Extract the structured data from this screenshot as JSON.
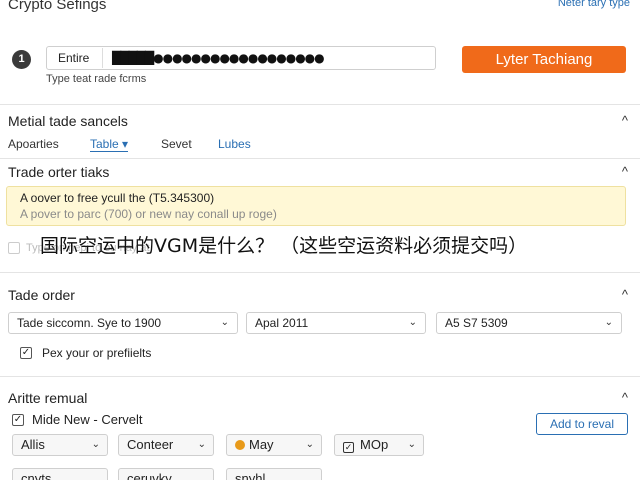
{
  "window": {
    "title": "Crypto Sefings",
    "top_link": "Neter tary type"
  },
  "api_key": {
    "step": "1",
    "label": "Entire",
    "masked_value": "█████●●●●●●●●●●●●●●●●●●",
    "help": "Type teat rade fcrms",
    "button": "Lyter Tachiang"
  },
  "section_metal": {
    "title": "Metial tade sancels",
    "chevron": "^",
    "tabs": [
      {
        "label": "Apoarties"
      },
      {
        "label": "Table ▾"
      },
      {
        "label": "Sevet"
      },
      {
        "label": "Lubes"
      }
    ]
  },
  "section_trade_tiaks": {
    "title": "Trade orter tiaks",
    "chevron": "^",
    "alert_line1": "A oover to free ycull the (T5.345300)",
    "alert_line2": "A pover to parc (700) or new nay conall up roge)",
    "ghost_text": "Type on hepi to ou nay at"
  },
  "overlay_text": "国际空运中的VGM是什么？ （这些空运资料必须提交吗）",
  "section_trade_order": {
    "title": "Tade order",
    "chevron": "^",
    "select1": "Tade siccomn. Sye to 1900",
    "select2": "Apal 2011",
    "select3": "A5 S7 5309",
    "checkbox_mark": "✓",
    "checkbox_label": "Pex your or prefiielts"
  },
  "section_arrite": {
    "title": "Aritte remual",
    "chevron": "^",
    "checkbox_mark": "✓",
    "checkbox_label": "Mide New - Cervelt",
    "add_button": "Add to reval",
    "pills_row1": [
      {
        "label": "Allis"
      },
      {
        "label": "Conteer"
      },
      {
        "label": "May"
      },
      {
        "label": "MOp"
      }
    ],
    "pills_row2": [
      {
        "label": "cnyts"
      },
      {
        "label": "ceruvky"
      },
      {
        "label": "snyhl"
      }
    ],
    "caret": "⌄"
  }
}
